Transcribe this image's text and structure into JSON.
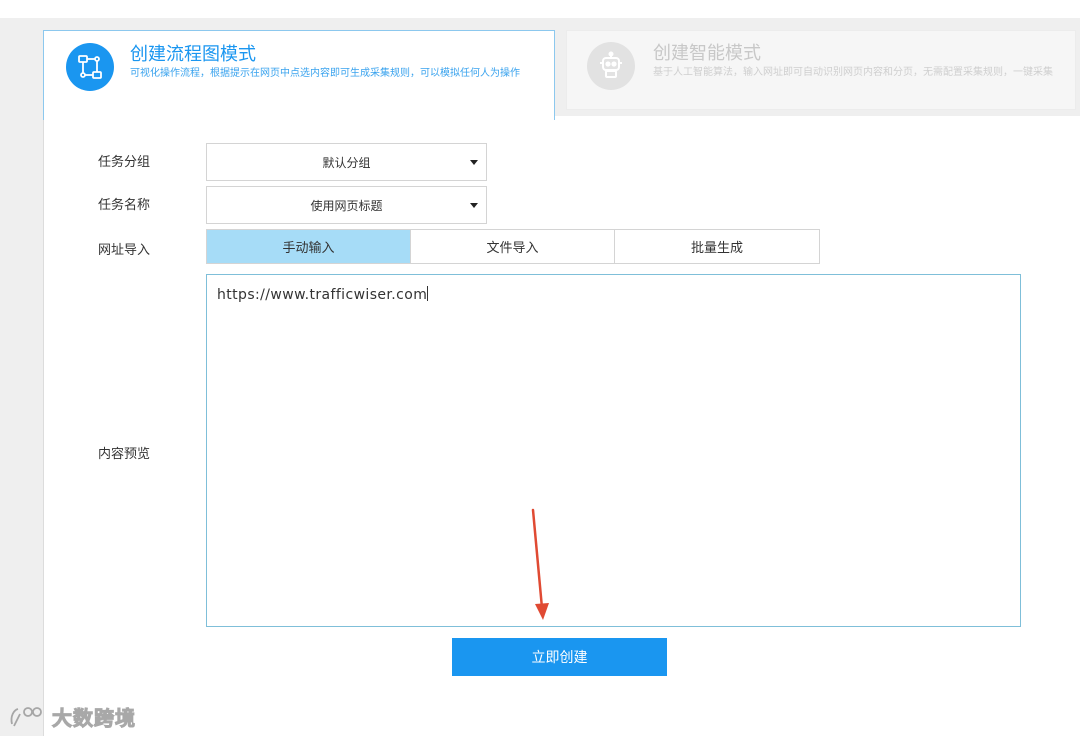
{
  "modes": {
    "flow": {
      "title": "创建流程图模式",
      "description": "可视化操作流程，根据提示在网页中点选内容即可生成采集规则，可以模拟任何人为操作",
      "icon": "flowchart-icon"
    },
    "smart": {
      "title": "创建智能模式",
      "description": "基于人工智能算法，输入网址即可自动识别网页内容和分页，无需配置采集规则，一键采集",
      "icon": "robot-icon"
    }
  },
  "form": {
    "group_label": "任务分组",
    "group_value": "默认分组",
    "name_label": "任务名称",
    "name_value": "使用网页标题",
    "url_import_label": "网址导入",
    "preview_label": "内容预览",
    "tabs": [
      {
        "label": "手动输入",
        "active": true
      },
      {
        "label": "文件导入",
        "active": false
      },
      {
        "label": "批量生成",
        "active": false
      }
    ],
    "url_text": "https://www.trafficwiser.com"
  },
  "actions": {
    "create_label": "立即创建"
  },
  "watermark": {
    "text": "大数跨境"
  },
  "colors": {
    "accent": "#1a96f0",
    "tab_active": "#a6dcf7",
    "arrow": "#e04a33"
  }
}
